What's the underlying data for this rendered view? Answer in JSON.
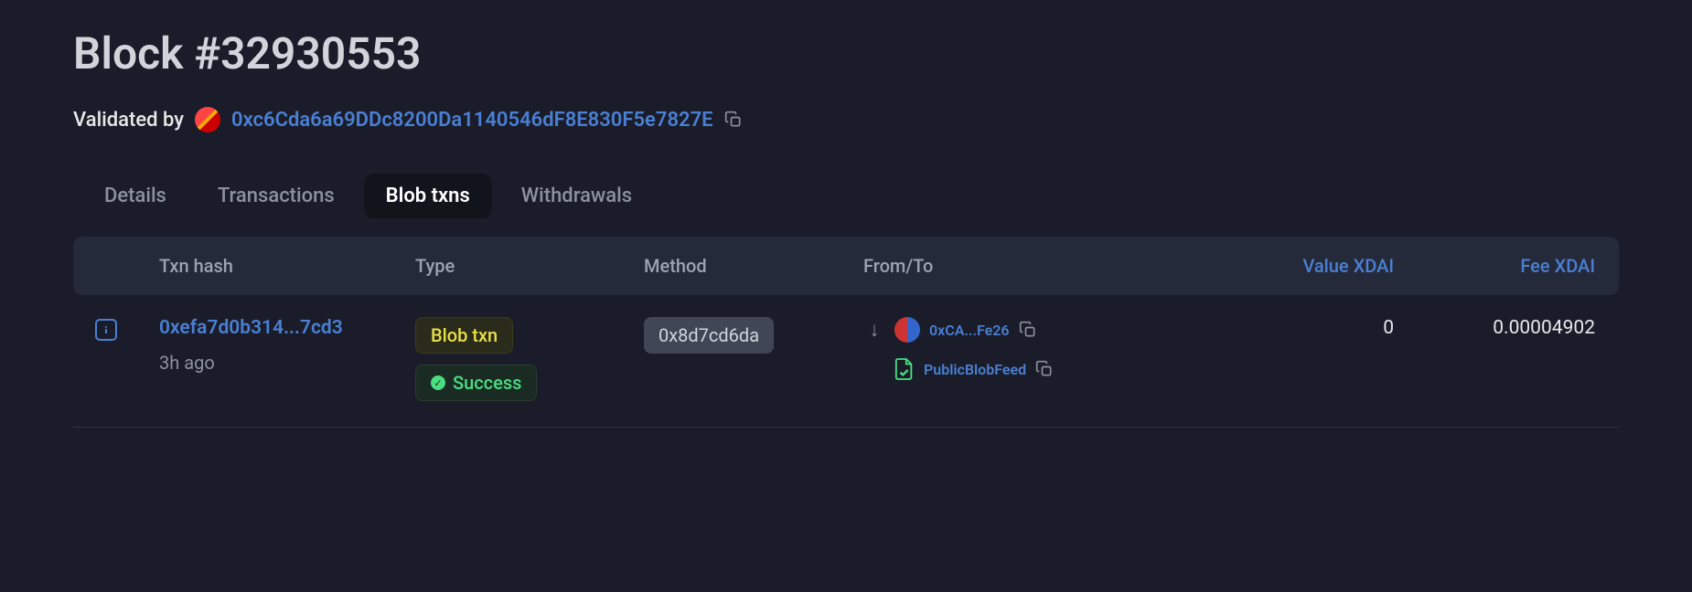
{
  "header": {
    "title": "Block #32930553",
    "validatedByLabel": "Validated by",
    "validatorAddress": "0xc6Cda6a69DDc8200Da1140546dF8E830F5e7827E"
  },
  "tabs": {
    "details": "Details",
    "transactions": "Transactions",
    "blobTxns": "Blob txns",
    "withdrawals": "Withdrawals"
  },
  "table": {
    "headers": {
      "txnHash": "Txn hash",
      "type": "Type",
      "method": "Method",
      "fromTo": "From/To",
      "value": "Value XDAI",
      "fee": "Fee XDAI"
    },
    "rows": [
      {
        "txnHash": "0xefa7d0b314...7cd3",
        "timeAgo": "3h ago",
        "typeBadge": "Blob txn",
        "statusBadge": "Success",
        "method": "0x8d7cd6da",
        "fromAddress": "0xCA...Fe26",
        "toName": "PublicBlobFeed",
        "value": "0",
        "fee": "0.00004902"
      }
    ]
  }
}
